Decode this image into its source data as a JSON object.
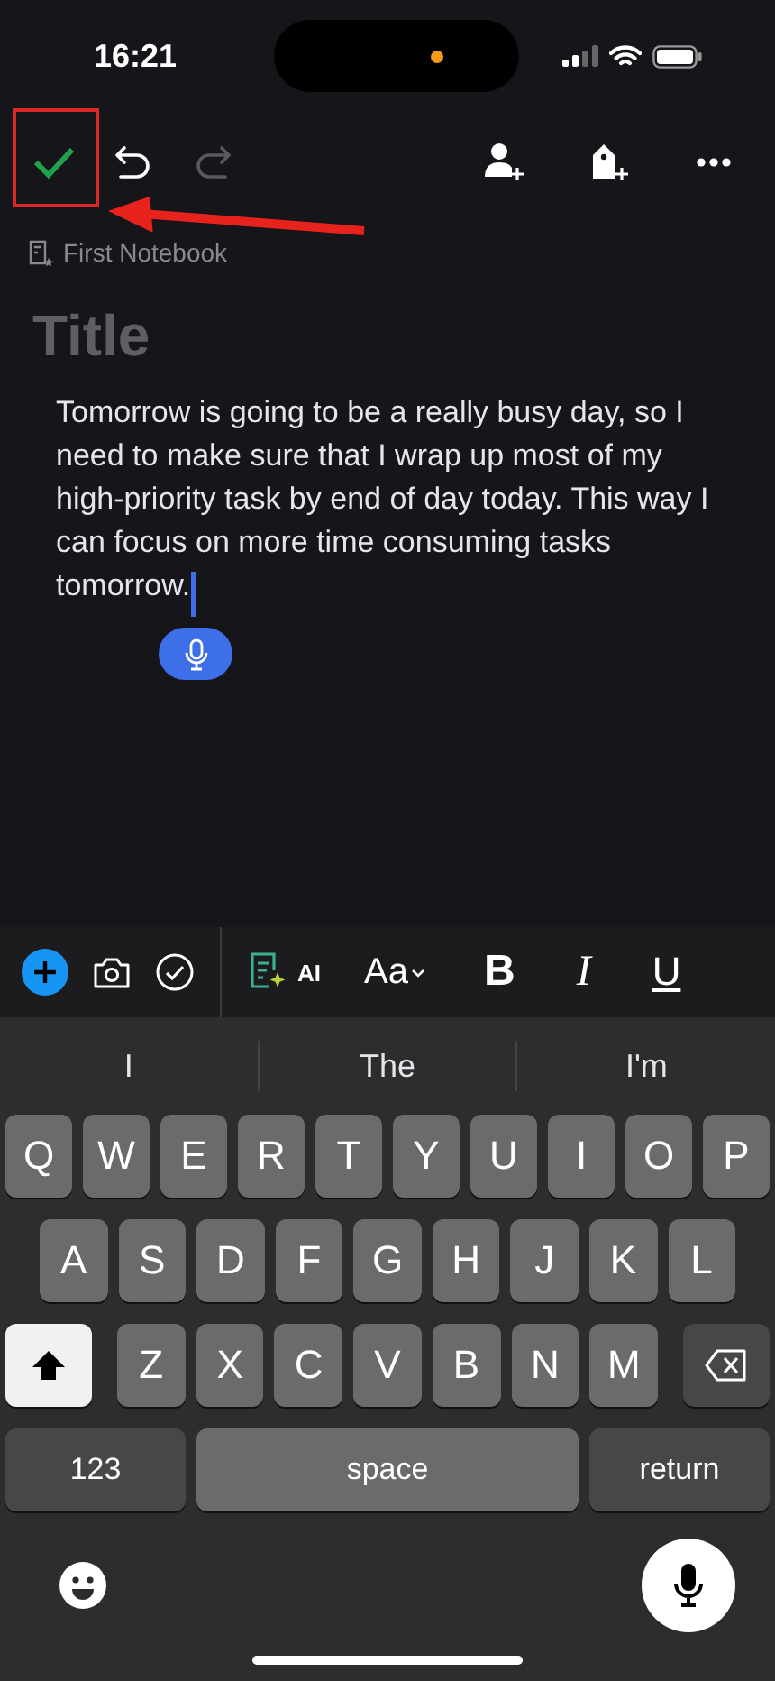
{
  "status_bar": {
    "time": "16:21"
  },
  "toolbar": {
    "undo": {
      "disabled": false
    },
    "redo": {
      "disabled": true
    }
  },
  "notebook": "First Notebook",
  "title": {
    "placeholder": "Title"
  },
  "body": "Tomorrow is going to be a really busy day, so I need to make sure that I wrap up most of my high-priority task by end of day today. This way I can focus on more time consuming tasks tomorrow.",
  "format_toolbar": {
    "ai": "AI",
    "font": "Aa",
    "bold": "B",
    "italic": "I",
    "underline": "U"
  },
  "suggestions": [
    "I",
    "The",
    "I'm"
  ],
  "keyboard": {
    "rows": [
      [
        "Q",
        "W",
        "E",
        "R",
        "T",
        "Y",
        "U",
        "I",
        "O",
        "P"
      ],
      [
        "A",
        "S",
        "D",
        "F",
        "G",
        "H",
        "J",
        "K",
        "L"
      ],
      [
        "Z",
        "X",
        "C",
        "V",
        "B",
        "N",
        "M"
      ]
    ],
    "shift": {
      "on": true
    },
    "numbers": "123",
    "space": "space",
    "return": "return"
  }
}
